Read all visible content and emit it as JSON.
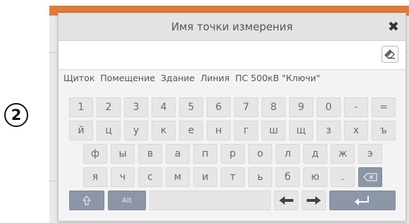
{
  "step_number": "2",
  "dialog": {
    "title": "Имя точки измерения",
    "close_icon": "close-icon",
    "eraser_icon": "eraser-icon",
    "input_value": ""
  },
  "suggestions": [
    "Щиток",
    "Помещение",
    "Здание",
    "Линия",
    "ПС 500кВ \"Ключи\""
  ],
  "keyboard": {
    "row1": [
      "1",
      "2",
      "3",
      "4",
      "5",
      "6",
      "7",
      "8",
      "9",
      "0",
      "-",
      "="
    ],
    "row2": [
      "й",
      "ц",
      "у",
      "к",
      "е",
      "н",
      "г",
      "ш",
      "щ",
      "з",
      "х",
      "ъ"
    ],
    "row3": [
      "ф",
      "ы",
      "в",
      "а",
      "п",
      "р",
      "о",
      "л",
      "д",
      "ж",
      "э"
    ],
    "row4": [
      "я",
      "ч",
      "с",
      "м",
      "и",
      "т",
      "ь",
      "б",
      "ю",
      "."
    ],
    "alt_label": "Alt",
    "icons": [
      "backspace-icon",
      "shift-icon",
      "left-arrow-icon",
      "right-arrow-icon",
      "enter-icon"
    ]
  },
  "colors": {
    "accent_key": "#8c96a6",
    "backdrop_bar": "#e07a3a"
  }
}
